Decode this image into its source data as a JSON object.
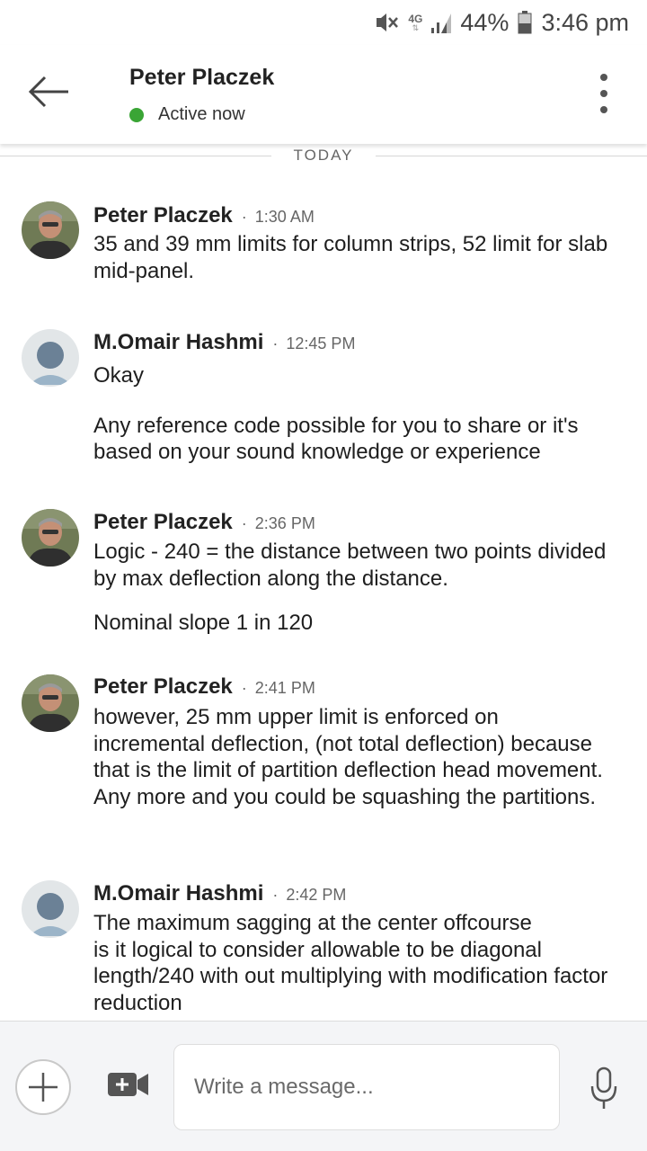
{
  "status_bar": {
    "network": "4G",
    "battery": "44%",
    "time": "3:46 pm",
    "icons": [
      "mute-vibrate-icon",
      "network-4g-icon",
      "signal-icon",
      "battery-icon"
    ]
  },
  "header": {
    "contact_name": "Peter Placzek",
    "status": "Active now",
    "status_color": "#3aa535",
    "icons": [
      "back-arrow-icon",
      "more-vert-icon"
    ]
  },
  "divider": {
    "label": "TODAY"
  },
  "messages": [
    {
      "sender": "Peter Placzek",
      "separator": "·",
      "time": "1:30 AM",
      "avatar": "photo",
      "paragraphs": [
        "35 and 39 mm limits for column strips, 52 limit for slab mid-panel."
      ]
    },
    {
      "sender": "M.Omair Hashmi",
      "separator": "·",
      "time": "12:45 PM",
      "avatar": "default",
      "paragraphs": [
        "Okay",
        "Any reference code possible for you to share or it's based on your sound knowledge or experience"
      ]
    },
    {
      "sender": "Peter Placzek",
      "separator": "·",
      "time": "2:36 PM",
      "avatar": "photo",
      "paragraphs": [
        "Logic - 240 = the distance between two points divided by max deflection along the distance.",
        "Nominal slope 1 in 120"
      ]
    },
    {
      "sender": "Peter Placzek",
      "separator": "·",
      "time": "2:41 PM",
      "avatar": "photo",
      "paragraphs": [
        "however, 25 mm upper limit is enforced on incremental deflection, (not total deflection) because that is the limit of partition deflection head movement. Any more and you could be squashing the partitions."
      ]
    },
    {
      "sender": "M.Omair Hashmi",
      "separator": "·",
      "time": "2:42 PM",
      "avatar": "default",
      "paragraphs": [
        "The maximum sagging at the center offcourse\nis it logical to consider allowable to be diagonal length/240 with out multiplying with modification factor reduction"
      ]
    }
  ],
  "composer": {
    "placeholder": "Write a message...",
    "icons": [
      "plus-icon",
      "video-icon",
      "microphone-icon"
    ]
  }
}
